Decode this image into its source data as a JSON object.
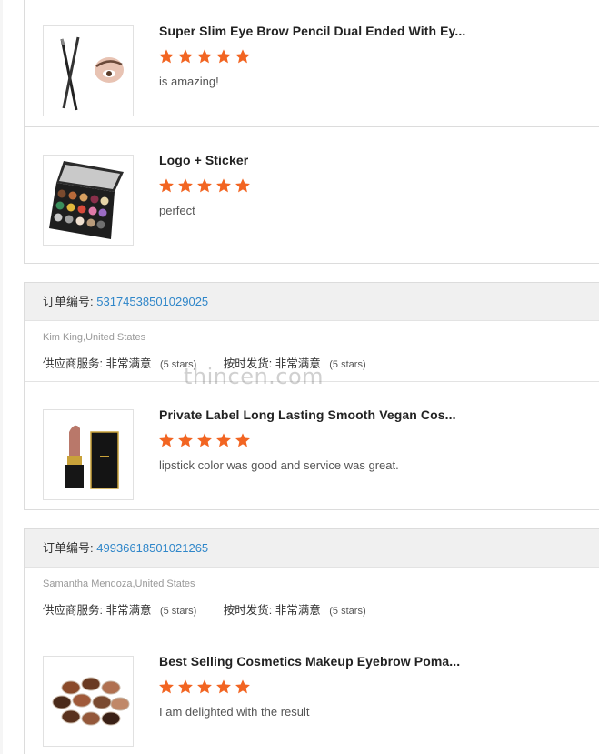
{
  "watermark": "thincen.com",
  "colors": {
    "star": "#f26522",
    "link": "#2f86c9",
    "header_bg": "#f0f0f0"
  },
  "icons": {
    "rating": "star-icon"
  },
  "top_card": {
    "items": [
      {
        "title": "Super Slim Eye Brow Pencil Dual Ended With Ey...",
        "rating": 5,
        "comment": "is amazing!"
      },
      {
        "title": "Logo + Sticker",
        "rating": 5,
        "comment": "perfect"
      }
    ]
  },
  "orders": [
    {
      "order_label": "订单编号:",
      "order_no": "53174538501029025",
      "buyer": "Kim King,United States",
      "supplier_label": "供应商服务:",
      "supplier_value": "非常满意",
      "supplier_note": "(5 stars)",
      "shipping_label": "按时发货:",
      "shipping_value": "非常满意",
      "shipping_note": "(5 stars)",
      "item": {
        "title": "Private Label Long Lasting Smooth Vegan Cos...",
        "rating": 5,
        "comment": "lipstick color was good and service was great."
      }
    },
    {
      "order_label": "订单编号:",
      "order_no": "49936618501021265",
      "buyer": "Samantha Mendoza,United States",
      "supplier_label": "供应商服务:",
      "supplier_value": "非常满意",
      "supplier_note": "(5 stars)",
      "shipping_label": "按时发货:",
      "shipping_value": "非常满意",
      "shipping_note": "(5 stars)",
      "item": {
        "title": "Best Selling Cosmetics Makeup Eyebrow Poma...",
        "rating": 5,
        "comment": "I am delighted with the result"
      }
    }
  ]
}
